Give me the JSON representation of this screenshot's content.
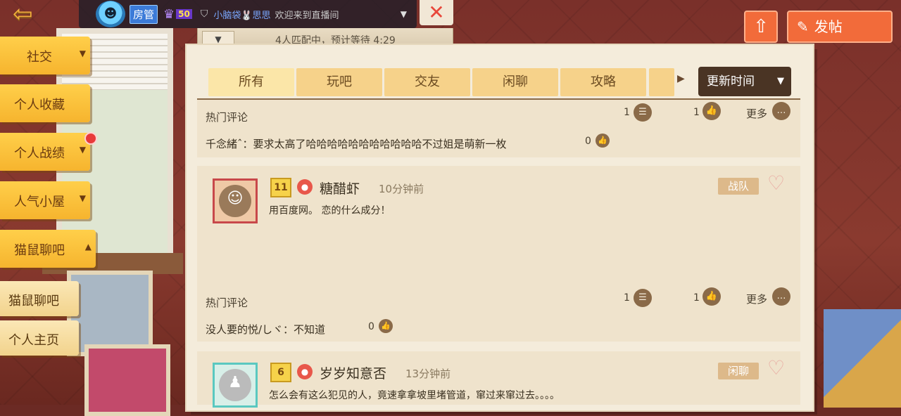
{
  "colors": {
    "accent": "#f26b3a",
    "tab": "#f6d28a",
    "sort_bg": "#4a3424",
    "sidebar": "#f6b42e"
  },
  "topbar": {
    "bot_icon": "robot-avatar-icon",
    "role": "房管",
    "level": "50",
    "username": "小脑袋🐰思思",
    "welcome": "欢迎来到直播间",
    "close_icon": "✕"
  },
  "match": {
    "status": "4人匹配中，预计等待 4:29",
    "toggle_icon": "▼"
  },
  "header_buttons": {
    "upload_icon": "⇧",
    "post_icon": "✎",
    "post_label": "发帖"
  },
  "sidebar": {
    "items": [
      {
        "label": "社交",
        "arrow": "▼"
      },
      {
        "label": "个人收藏",
        "arrow": ""
      },
      {
        "label": "个人战绩",
        "arrow": "▼"
      },
      {
        "label": "人气小屋",
        "arrow": "▼"
      },
      {
        "label": "猫鼠聊吧",
        "arrow": "▲"
      },
      {
        "label": "猫鼠聊吧",
        "arrow": ""
      },
      {
        "label": "个人主页",
        "arrow": ""
      }
    ]
  },
  "tabs": [
    {
      "label": "所有"
    },
    {
      "label": "玩吧"
    },
    {
      "label": "交友"
    },
    {
      "label": "闲聊"
    },
    {
      "label": "攻略"
    },
    {
      "label": ""
    }
  ],
  "sort": {
    "label": "更新时间",
    "arrow": "▼",
    "next_arrow": "▶"
  },
  "posts": [
    {
      "hot_label": "热门评论",
      "comment_count": "1",
      "like_count": "1",
      "more_label": "更多",
      "hot_comment": "千念緒ˆ：要求太高了哈哈哈哈哈哈哈哈哈哈哈不过姐是萌新一枚",
      "hot_comment_likes": "0"
    },
    {
      "level": "11",
      "username": "糖醋虾",
      "time": "10分钟前",
      "category": "战队",
      "body": "用百度网。 恋的什么成分！",
      "hot_label": "热门评论",
      "comment_count": "1",
      "like_count": "1",
      "more_label": "更多",
      "hot_comment": "没人要的悦/しヾ：不知道",
      "hot_comment_likes": "0"
    },
    {
      "level": "6",
      "username": "岁岁知意否",
      "time": "13分钟前",
      "category": "闲聊",
      "body": "怎么会有这么犯见的人，竟速拿拿坡里堵管道，窜过来窜过去。。。。"
    }
  ]
}
